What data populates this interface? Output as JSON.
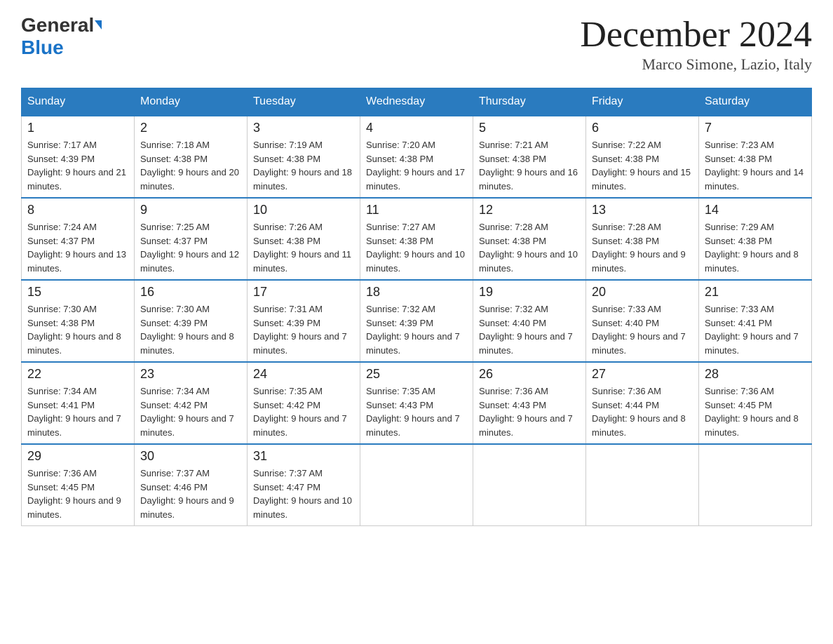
{
  "header": {
    "logo_general": "General",
    "logo_blue": "Blue",
    "month_title": "December 2024",
    "location": "Marco Simone, Lazio, Italy"
  },
  "weekdays": [
    "Sunday",
    "Monday",
    "Tuesday",
    "Wednesday",
    "Thursday",
    "Friday",
    "Saturday"
  ],
  "weeks": [
    [
      {
        "day": "1",
        "sunrise": "7:17 AM",
        "sunset": "4:39 PM",
        "daylight": "9 hours and 21 minutes."
      },
      {
        "day": "2",
        "sunrise": "7:18 AM",
        "sunset": "4:38 PM",
        "daylight": "9 hours and 20 minutes."
      },
      {
        "day": "3",
        "sunrise": "7:19 AM",
        "sunset": "4:38 PM",
        "daylight": "9 hours and 18 minutes."
      },
      {
        "day": "4",
        "sunrise": "7:20 AM",
        "sunset": "4:38 PM",
        "daylight": "9 hours and 17 minutes."
      },
      {
        "day": "5",
        "sunrise": "7:21 AM",
        "sunset": "4:38 PM",
        "daylight": "9 hours and 16 minutes."
      },
      {
        "day": "6",
        "sunrise": "7:22 AM",
        "sunset": "4:38 PM",
        "daylight": "9 hours and 15 minutes."
      },
      {
        "day": "7",
        "sunrise": "7:23 AM",
        "sunset": "4:38 PM",
        "daylight": "9 hours and 14 minutes."
      }
    ],
    [
      {
        "day": "8",
        "sunrise": "7:24 AM",
        "sunset": "4:37 PM",
        "daylight": "9 hours and 13 minutes."
      },
      {
        "day": "9",
        "sunrise": "7:25 AM",
        "sunset": "4:37 PM",
        "daylight": "9 hours and 12 minutes."
      },
      {
        "day": "10",
        "sunrise": "7:26 AM",
        "sunset": "4:38 PM",
        "daylight": "9 hours and 11 minutes."
      },
      {
        "day": "11",
        "sunrise": "7:27 AM",
        "sunset": "4:38 PM",
        "daylight": "9 hours and 10 minutes."
      },
      {
        "day": "12",
        "sunrise": "7:28 AM",
        "sunset": "4:38 PM",
        "daylight": "9 hours and 10 minutes."
      },
      {
        "day": "13",
        "sunrise": "7:28 AM",
        "sunset": "4:38 PM",
        "daylight": "9 hours and 9 minutes."
      },
      {
        "day": "14",
        "sunrise": "7:29 AM",
        "sunset": "4:38 PM",
        "daylight": "9 hours and 8 minutes."
      }
    ],
    [
      {
        "day": "15",
        "sunrise": "7:30 AM",
        "sunset": "4:38 PM",
        "daylight": "9 hours and 8 minutes."
      },
      {
        "day": "16",
        "sunrise": "7:30 AM",
        "sunset": "4:39 PM",
        "daylight": "9 hours and 8 minutes."
      },
      {
        "day": "17",
        "sunrise": "7:31 AM",
        "sunset": "4:39 PM",
        "daylight": "9 hours and 7 minutes."
      },
      {
        "day": "18",
        "sunrise": "7:32 AM",
        "sunset": "4:39 PM",
        "daylight": "9 hours and 7 minutes."
      },
      {
        "day": "19",
        "sunrise": "7:32 AM",
        "sunset": "4:40 PM",
        "daylight": "9 hours and 7 minutes."
      },
      {
        "day": "20",
        "sunrise": "7:33 AM",
        "sunset": "4:40 PM",
        "daylight": "9 hours and 7 minutes."
      },
      {
        "day": "21",
        "sunrise": "7:33 AM",
        "sunset": "4:41 PM",
        "daylight": "9 hours and 7 minutes."
      }
    ],
    [
      {
        "day": "22",
        "sunrise": "7:34 AM",
        "sunset": "4:41 PM",
        "daylight": "9 hours and 7 minutes."
      },
      {
        "day": "23",
        "sunrise": "7:34 AM",
        "sunset": "4:42 PM",
        "daylight": "9 hours and 7 minutes."
      },
      {
        "day": "24",
        "sunrise": "7:35 AM",
        "sunset": "4:42 PM",
        "daylight": "9 hours and 7 minutes."
      },
      {
        "day": "25",
        "sunrise": "7:35 AM",
        "sunset": "4:43 PM",
        "daylight": "9 hours and 7 minutes."
      },
      {
        "day": "26",
        "sunrise": "7:36 AM",
        "sunset": "4:43 PM",
        "daylight": "9 hours and 7 minutes."
      },
      {
        "day": "27",
        "sunrise": "7:36 AM",
        "sunset": "4:44 PM",
        "daylight": "9 hours and 8 minutes."
      },
      {
        "day": "28",
        "sunrise": "7:36 AM",
        "sunset": "4:45 PM",
        "daylight": "9 hours and 8 minutes."
      }
    ],
    [
      {
        "day": "29",
        "sunrise": "7:36 AM",
        "sunset": "4:45 PM",
        "daylight": "9 hours and 9 minutes."
      },
      {
        "day": "30",
        "sunrise": "7:37 AM",
        "sunset": "4:46 PM",
        "daylight": "9 hours and 9 minutes."
      },
      {
        "day": "31",
        "sunrise": "7:37 AM",
        "sunset": "4:47 PM",
        "daylight": "9 hours and 10 minutes."
      },
      null,
      null,
      null,
      null
    ]
  ]
}
